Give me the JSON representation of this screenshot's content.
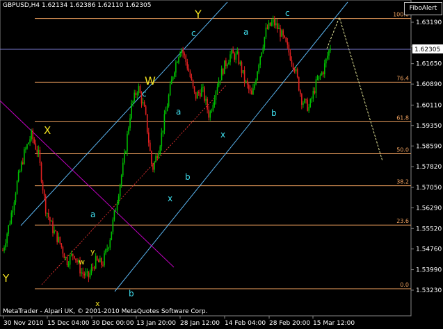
{
  "header": {
    "symbol": "GBPUSD,H4",
    "ohlc": "1.62134 1.62386 1.62110 1.62305"
  },
  "indicator_button": "FiboAlert",
  "footer": "MetaTrader - Alpari UK, © 2001-2010 MetaQuotes Software Corp.",
  "current_price": "1.62305",
  "colors": {
    "background": "#000000",
    "grid": "#6f6f6f",
    "bull_candle": "#00c000",
    "bear_candle": "#e02020",
    "fibo": "#f4a460",
    "channel": "#5ab4f0",
    "wave_yellow": "#f0e020",
    "wave_cyan": "#40e0f0",
    "magenta": "#c000c0",
    "price_line": "#7a7ad0"
  },
  "chart_data": {
    "type": "candlestick",
    "y_ticks": [
      "1.63190",
      "1.62305",
      "1.61650",
      "1.60890",
      "1.60110",
      "1.59350",
      "1.58590",
      "1.57820",
      "1.57050",
      "1.56290",
      "1.55520",
      "1.54760",
      "1.53990",
      "1.53230"
    ],
    "x_ticks": [
      "30 Nov 2010",
      "15 Dec 04:00",
      "30 Dec 00:00",
      "13 Jan 20:00",
      "28 Jan 12:00",
      "14 Feb 04:00",
      "28 Feb 20:00",
      "15 Mar 12:00"
    ],
    "fibo_levels": [
      {
        "label": "100.0",
        "price": 1.6333
      },
      {
        "label": "76.4",
        "price": 1.6096
      },
      {
        "label": "61.8",
        "price": 1.5949
      },
      {
        "label": "50.0",
        "price": 1.583
      },
      {
        "label": "38.2",
        "price": 1.5711
      },
      {
        "label": "23.6",
        "price": 1.5565
      },
      {
        "label": "0.0",
        "price": 1.5328
      }
    ],
    "wave_labels": [
      {
        "text": "Y",
        "color": "yellow"
      },
      {
        "text": "W",
        "color": "yellow"
      },
      {
        "text": "X",
        "color": "yellow"
      },
      {
        "text": "Y",
        "color": "yellow"
      },
      {
        "text": "w",
        "color": "yellow"
      },
      {
        "text": "y",
        "color": "yellow"
      },
      {
        "text": "x",
        "color": "yellow"
      },
      {
        "text": "c",
        "color": "cyan"
      },
      {
        "text": "c",
        "color": "cyan"
      },
      {
        "text": "a",
        "color": "cyan"
      },
      {
        "text": "a",
        "color": "cyan"
      },
      {
        "text": "a",
        "color": "cyan"
      },
      {
        "text": "b",
        "color": "cyan"
      },
      {
        "text": "b",
        "color": "cyan"
      },
      {
        "text": "b",
        "color": "cyan"
      },
      {
        "text": "x",
        "color": "cyan"
      },
      {
        "text": "x",
        "color": "cyan"
      },
      {
        "text": "c",
        "color": "cyan"
      }
    ],
    "trend": [
      1.547,
      1.558,
      1.572,
      1.583,
      1.59,
      1.583,
      1.563,
      1.555,
      1.55,
      1.543,
      1.546,
      1.539,
      1.537,
      1.543,
      1.542,
      1.551,
      1.565,
      1.58,
      1.6,
      1.608,
      1.598,
      1.577,
      1.586,
      1.6,
      1.614,
      1.623,
      1.615,
      1.604,
      1.607,
      1.597,
      1.608,
      1.615,
      1.62,
      1.619,
      1.61,
      1.604,
      1.618,
      1.629,
      1.632,
      1.628,
      1.622,
      1.615,
      1.603,
      1.6,
      1.609,
      1.614,
      1.623
    ]
  }
}
